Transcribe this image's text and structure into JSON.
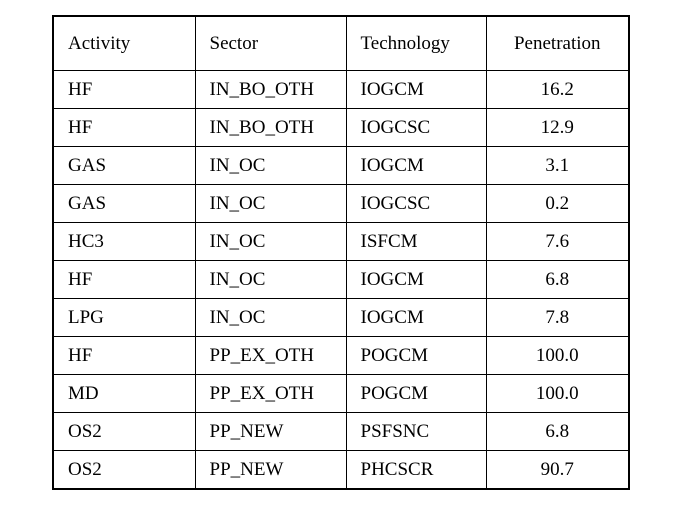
{
  "table": {
    "columns": [
      {
        "key": "activity",
        "label": "Activity",
        "align": "left"
      },
      {
        "key": "sector",
        "label": "Sector",
        "align": "left"
      },
      {
        "key": "technology",
        "label": "Technology",
        "align": "left"
      },
      {
        "key": "penetration",
        "label": "Penetration",
        "align": "center"
      }
    ],
    "rows": [
      {
        "activity": "HF",
        "sector": "IN_BO_OTH",
        "technology": "IOGCM",
        "penetration": "16.2"
      },
      {
        "activity": "HF",
        "sector": "IN_BO_OTH",
        "technology": "IOGCSC",
        "penetration": "12.9"
      },
      {
        "activity": "GAS",
        "sector": "IN_OC",
        "technology": "IOGCM",
        "penetration": "3.1"
      },
      {
        "activity": "GAS",
        "sector": "IN_OC",
        "technology": "IOGCSC",
        "penetration": "0.2"
      },
      {
        "activity": "HC3",
        "sector": "IN_OC",
        "technology": "ISFCM",
        "penetration": "7.6"
      },
      {
        "activity": "HF",
        "sector": "IN_OC",
        "technology": "IOGCM",
        "penetration": "6.8"
      },
      {
        "activity": "LPG",
        "sector": "IN_OC",
        "technology": "IOGCM",
        "penetration": "7.8"
      },
      {
        "activity": "HF",
        "sector": "PP_EX_OTH",
        "technology": "POGCM",
        "penetration": "100.0"
      },
      {
        "activity": "MD",
        "sector": "PP_EX_OTH",
        "technology": "POGCM",
        "penetration": "100.0"
      },
      {
        "activity": "OS2",
        "sector": "PP_NEW",
        "technology": "PSFSNC",
        "penetration": "6.8"
      },
      {
        "activity": "OS2",
        "sector": "PP_NEW",
        "technology": "PHCSCR",
        "penetration": "90.7"
      }
    ]
  },
  "style": {
    "background": "#ffffff",
    "text_color": "#000000",
    "border_color": "#000000"
  }
}
